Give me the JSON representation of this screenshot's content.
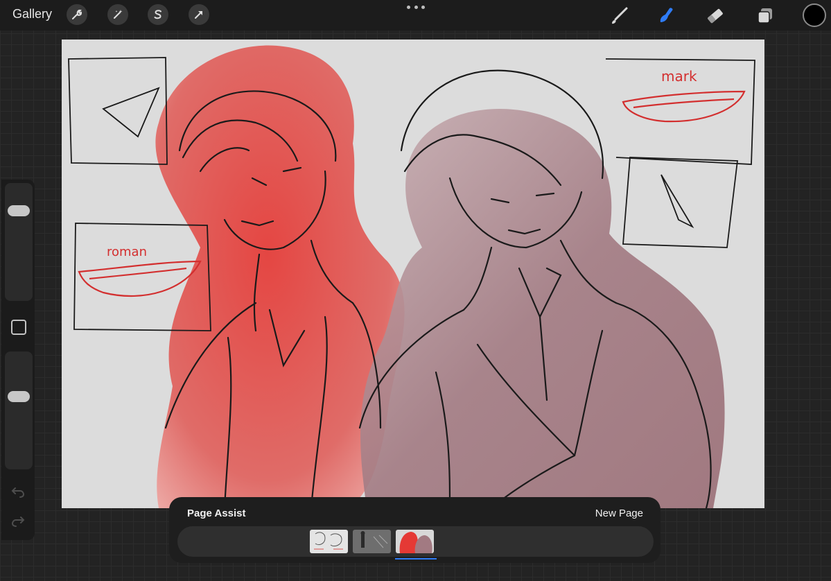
{
  "toolbar": {
    "gallery_label": "Gallery",
    "left_tools": [
      "wrench-icon",
      "magic-wand-icon",
      "selection-s-icon",
      "transform-arrow-icon"
    ],
    "right_tools": [
      "brush-icon",
      "smudge-icon",
      "eraser-icon",
      "layers-icon"
    ],
    "active_tool": "smudge-icon",
    "accent_color": "#2f7cf6",
    "current_color": "#000000"
  },
  "canvas": {
    "sketch_labels": {
      "left": "roman",
      "right": "mark"
    }
  },
  "page_assist": {
    "title": "Page Assist",
    "new_page_label": "New Page",
    "selected_page": 3
  }
}
